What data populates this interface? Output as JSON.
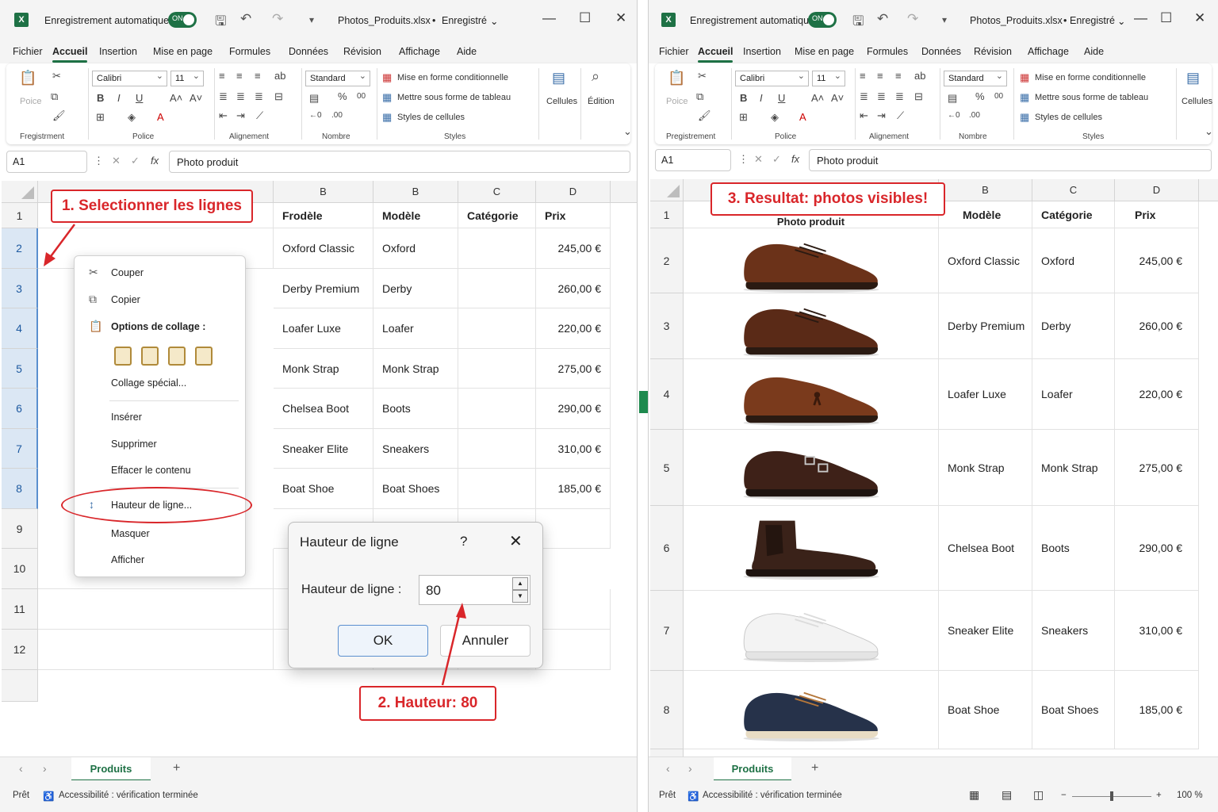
{
  "title_bar": {
    "autosave_label": "Enregistrement automatique",
    "toggle_text": "ON",
    "filename": "Photos_Produits.xlsx",
    "separator": "•",
    "save_state": "Enregistré"
  },
  "menu": [
    "Fichier",
    "Accueil",
    "Insertion",
    "Mise en page",
    "Formules",
    "Données",
    "Révision",
    "Affichage",
    "Aide"
  ],
  "ribbon": {
    "font_name": "Calibri",
    "font_size": "11",
    "number_format": "Standard",
    "conditional": "Mise en forme conditionnelle",
    "as_table": "Mettre sous forme de tableau",
    "cell_styles": "Styles de cellules",
    "cells": "Cellules",
    "edition": "Édition",
    "paste": "Poice",
    "groups": {
      "clipboard": "Fregistrment",
      "clipboard_right": "Pregistrement",
      "font": "Police",
      "alignment": "Alignement",
      "number": "Nombre",
      "styles": "Styles"
    }
  },
  "formula_bar": {
    "name_box": "A1",
    "fx": "fx",
    "content": "Photo produit"
  },
  "left": {
    "columns": [
      "B",
      "B",
      "C",
      "D"
    ],
    "header": {
      "name": "Frodèle",
      "model": "Modèle",
      "category": "Catégorie",
      "price": "Prix"
    },
    "rows": [
      {
        "num": "1"
      },
      {
        "num": "2",
        "name": "Oxford Classic",
        "model": "Oxford",
        "price": "245,00 €"
      },
      {
        "num": "3",
        "name": "Derby Premium",
        "model": "Derby",
        "price": "260,00 €"
      },
      {
        "num": "4",
        "name": "Loafer Luxe",
        "model": "Loafer",
        "price": "220,00 €"
      },
      {
        "num": "5",
        "name": "Monk Strap",
        "model": "Monk Strap",
        "price": "275,00 €"
      },
      {
        "num": "6",
        "name": "Chelsea Boot",
        "model": "Boots",
        "price": "290,00 €"
      },
      {
        "num": "7",
        "name": "Sneaker Elite",
        "model": "Sneakers",
        "price": "310,00 €"
      },
      {
        "num": "8",
        "name": "Boat Shoe",
        "model": "Boat Shoes",
        "price": "185,00 €"
      },
      {
        "num": "9"
      },
      {
        "num": "10"
      },
      {
        "num": "11"
      },
      {
        "num": "12"
      }
    ]
  },
  "context_menu": {
    "cut": "Couper",
    "copy": "Copier",
    "paste_options": "Options de collage :",
    "paste_special": "Collage spécial...",
    "insert": "Insérer",
    "delete": "Supprimer",
    "clear": "Effacer le contenu",
    "row_height": "Hauteur de ligne...",
    "hide": "Masquer",
    "show": "Afficher"
  },
  "dialog": {
    "title": "Hauteur de ligne",
    "help": "?",
    "label": "Hauteur de ligne :",
    "value": "80",
    "ok": "OK",
    "cancel": "Annuler"
  },
  "callouts": {
    "step1": "1. Selectionner les lignes",
    "step2": "2. Hauteur: 80",
    "step3": "3. Resultat: photos visibles!"
  },
  "right": {
    "columns": [
      "B",
      "C",
      "D"
    ],
    "header": {
      "photo": "Photo produit",
      "model": "Modèle",
      "category": "Catégorie",
      "price": "Prix"
    },
    "rows": [
      {
        "num": "2",
        "name": "Oxford Classic",
        "model": "Oxford",
        "price": "245,00 €",
        "photo": "oxford-shoe-photo"
      },
      {
        "num": "3",
        "name": "Derby Premium",
        "model": "Derby",
        "price": "260,00 €",
        "photo": "derby-shoe-photo"
      },
      {
        "num": "4",
        "name": "Loafer Luxe",
        "model": "Loafer",
        "price": "220,00 €",
        "photo": "loafer-shoe-photo"
      },
      {
        "num": "5",
        "name": "Monk Strap",
        "model": "Monk Strap",
        "price": "275,00 €",
        "photo": "monk-strap-shoe-photo"
      },
      {
        "num": "6",
        "name": "Chelsea Boot",
        "model": "Boots",
        "price": "290,00 €",
        "photo": "chelsea-boot-photo"
      },
      {
        "num": "7",
        "name": "Sneaker Elite",
        "model": "Sneakers",
        "price": "310,00 €",
        "photo": "white-sneaker-photo"
      },
      {
        "num": "8",
        "name": "Boat Shoe",
        "model": "Boat Shoes",
        "price": "185,00 €",
        "photo": "boat-shoe-photo"
      }
    ]
  },
  "sheet_tab": "Produits",
  "status": {
    "ready": "Prêt",
    "accessibility": "Accessibilité : vérification terminée",
    "zoom": "100 %"
  },
  "colors": {
    "excel_green": "#1e7145",
    "callout_red": "#d9262a",
    "selection_blue": "#dbe7f4"
  }
}
